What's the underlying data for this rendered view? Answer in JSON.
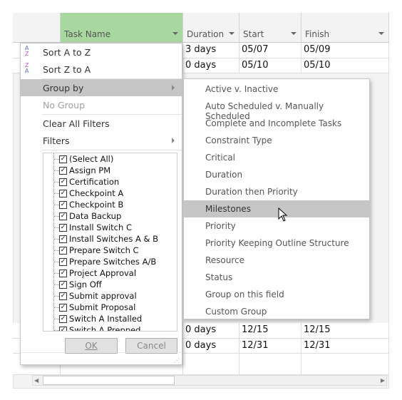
{
  "columns": [
    {
      "label": "Task Name"
    },
    {
      "label": "Duration"
    },
    {
      "label": "Start"
    },
    {
      "label": "Finish"
    }
  ],
  "rows_top": [
    [
      "3 days",
      "05/07",
      "05/09"
    ],
    [
      "0 days",
      "05/10",
      "05/10"
    ]
  ],
  "rows_bottom": [
    [
      "0 days",
      "12/15",
      "12/15"
    ],
    [
      "0 days",
      "12/31",
      "12/31"
    ]
  ],
  "menu": {
    "sort_az": "Sort A to Z",
    "sort_za": "Sort Z to A",
    "group_by": "Group by",
    "no_group": "No Group",
    "clear_filters": "Clear All Filters",
    "filters": "Filters",
    "ok": "OK",
    "cancel": "Cancel",
    "filter_items": [
      "(Select All)",
      "Assign PM",
      "Certification",
      "Checkpoint A",
      "Checkpoint B",
      "Data Backup",
      "Install Switch C",
      "Install Switches A & B",
      "Prepare Switch C",
      "Prepare Switches A/B",
      "Project Approval",
      "Sign Off",
      "Submit approval",
      "Submit Proposal",
      "Switch A Installed",
      "Switch A Prepped"
    ]
  },
  "group_submenu": [
    "Active v. Inactive",
    "Auto Scheduled v. Manually Scheduled",
    "Complete and Incomplete Tasks",
    "Constraint Type",
    "Critical",
    "Duration",
    "Duration then Priority",
    "Milestones",
    "Priority",
    "Priority Keeping Outline Structure",
    "Resource",
    "Status",
    "Group on this field",
    "Custom Group"
  ],
  "highlighted_group": "Milestones",
  "colors": {
    "task_header": "#a9d7a0",
    "highlight": "#c6c6c6"
  }
}
